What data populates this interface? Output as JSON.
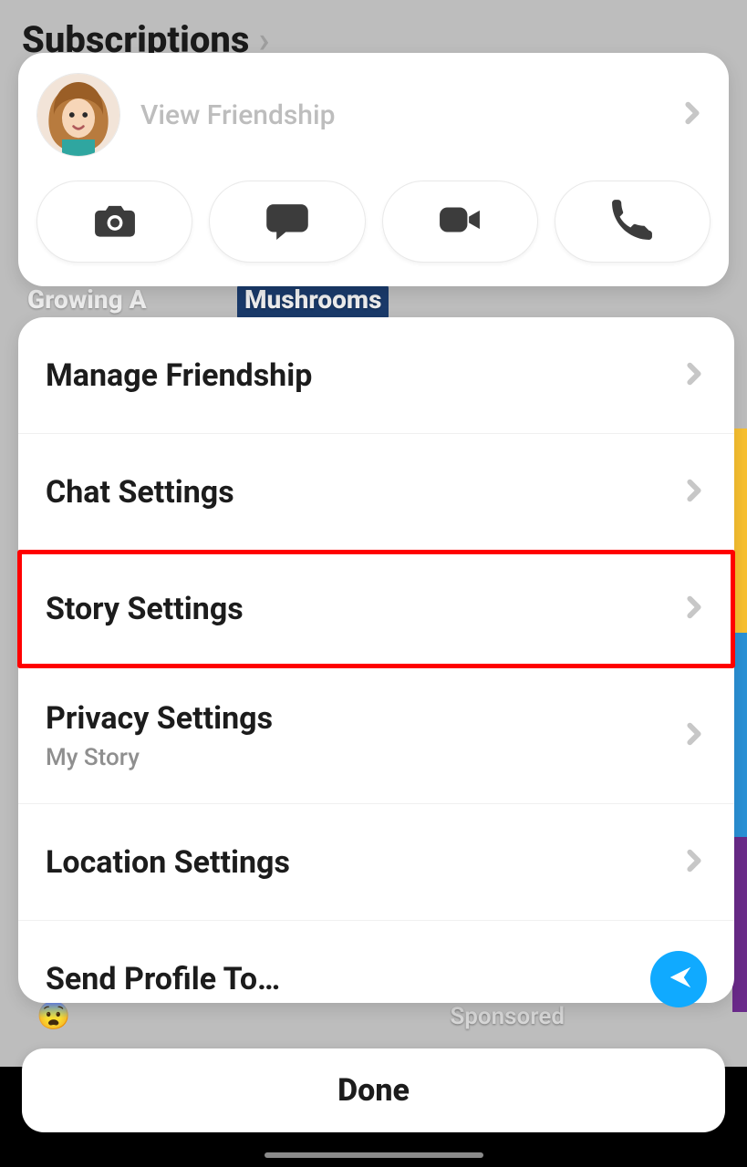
{
  "background": {
    "header": "Subscriptions",
    "chip_a": "Growing A",
    "chip_b": "Mushrooms",
    "sponsored": "Sponsored"
  },
  "profile": {
    "view_friendship": "View Friendship"
  },
  "menu": {
    "items": [
      {
        "label": "Manage Friendship",
        "sub": "",
        "type": "chevron",
        "highlight": false
      },
      {
        "label": "Chat Settings",
        "sub": "",
        "type": "chevron",
        "highlight": false
      },
      {
        "label": "Story Settings",
        "sub": "",
        "type": "chevron",
        "highlight": true
      },
      {
        "label": "Privacy Settings",
        "sub": "My Story",
        "type": "chevron",
        "highlight": false
      },
      {
        "label": "Location Settings",
        "sub": "",
        "type": "chevron",
        "highlight": false
      },
      {
        "label": "Send Profile To…",
        "sub": "",
        "type": "send",
        "highlight": false
      }
    ]
  },
  "done_label": "Done"
}
